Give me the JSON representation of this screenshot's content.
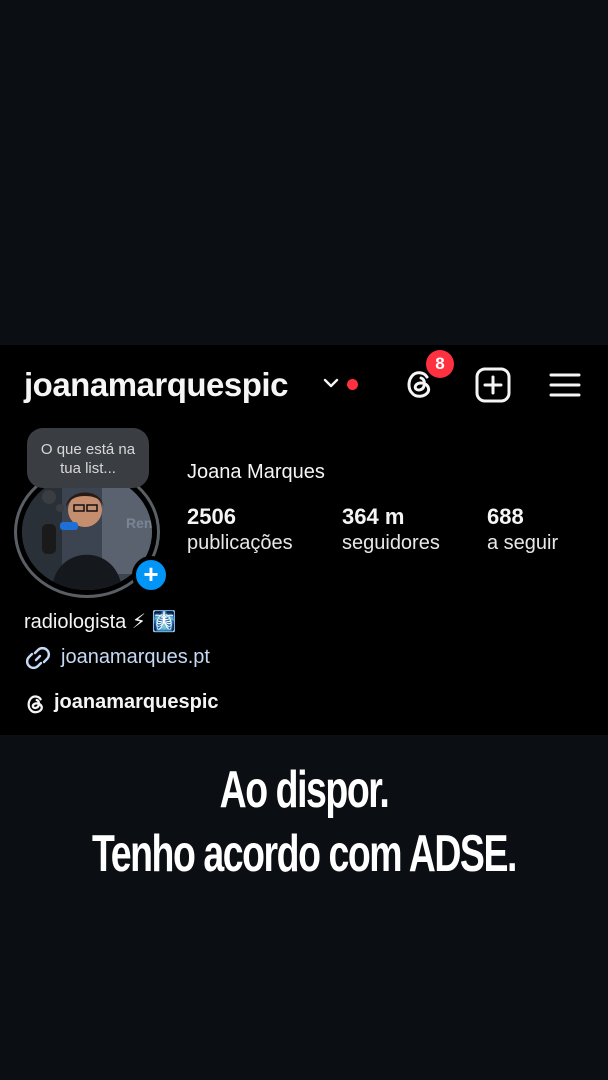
{
  "profile": {
    "username": "joanamarquespic",
    "full_name": "Joana Marques",
    "threads_badge_count": "8",
    "note_text": "O que está na tua list...",
    "stats": [
      {
        "value": "2506",
        "label": "publicações"
      },
      {
        "value": "364 m",
        "label": "seguidores"
      },
      {
        "value": "688",
        "label": "a seguir"
      }
    ],
    "bio": "radiologista ⚡ 🩻",
    "link": "joanamarques.pt",
    "threads_handle": "joanamarquespic"
  },
  "icons": {
    "header": [
      "chevron-down-icon",
      "threads-icon",
      "add-post-icon",
      "menu-icon"
    ],
    "inline": [
      "link-icon",
      "threads-icon"
    ]
  },
  "colors": {
    "accent_red": "#ff3040",
    "accent_blue": "#0095f6",
    "link_color": "#c6d9f5",
    "background": "#0b0e13"
  },
  "caption": {
    "line1": "Ao dispor.",
    "line2": "Tenho acordo com ADSE."
  }
}
